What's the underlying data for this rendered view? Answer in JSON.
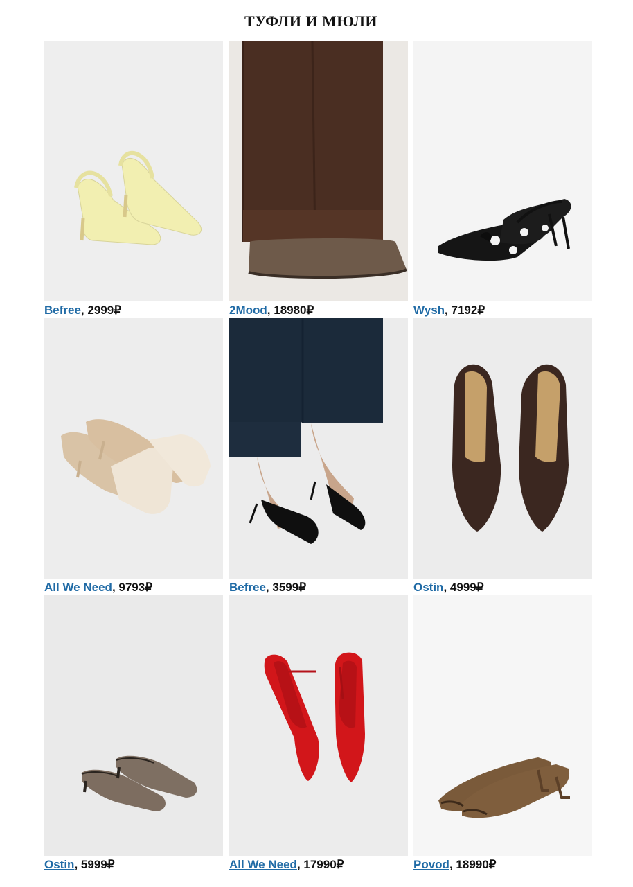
{
  "title": "ТУФЛИ И МЮЛИ",
  "products": [
    {
      "brand": "Befree",
      "price": "2999₽",
      "image": "yellow-slingback-heels",
      "bg": "#eeeeee",
      "color": "#f1eeae"
    },
    {
      "brand": "2Mood",
      "price": "18980₽",
      "image": "brown-suede-mules-model",
      "bg": "#ebe8e4",
      "color": "#6c5a4a"
    },
    {
      "brand": "Wysh",
      "price": "7192₽",
      "image": "black-polka-dot-slingbacks",
      "bg": "#f3f3f3",
      "color": "#1a1a1a"
    },
    {
      "brand": "All We Need",
      "price": "9793₽",
      "image": "cream-square-toe-mules",
      "bg": "#ededed",
      "color": "#ece0cf"
    },
    {
      "brand": "Befree",
      "price": "3599₽",
      "image": "black-mules-model",
      "bg": "#ececec",
      "color": "#111111"
    },
    {
      "brand": "Ostin",
      "price": "4999₽",
      "image": "brown-pointed-pumps",
      "bg": "#ececec",
      "color": "#3a2722"
    },
    {
      "brand": "Ostin",
      "price": "5999₽",
      "image": "taupe-suede-mules",
      "bg": "#eaeaea",
      "color": "#7e6f62"
    },
    {
      "brand": "All We Need",
      "price": "17990₽",
      "image": "red-patent-pumps",
      "bg": "#ececec",
      "color": "#d2161a"
    },
    {
      "brand": "Povod",
      "price": "18990₽",
      "image": "brown-peep-toe-kitten-heels",
      "bg": "#f5f5f5",
      "color": "#7a5a3a"
    }
  ]
}
